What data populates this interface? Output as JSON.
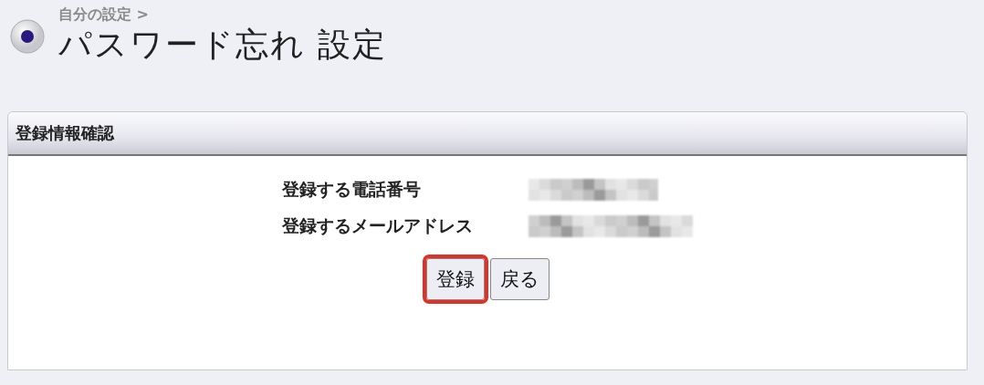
{
  "breadcrumb": "自分の設定 >",
  "title": "パスワード忘れ 設定",
  "panel": {
    "heading": "登録情報確認",
    "rows": [
      {
        "label": "登録する電話番号",
        "value": {
          "kind": "redacted"
        }
      },
      {
        "label": "登録するメールアドレス",
        "value": {
          "kind": "redacted"
        }
      }
    ],
    "buttons": [
      {
        "label": "登録",
        "highlighted": true
      },
      {
        "label": "戻る",
        "highlighted": false
      }
    ]
  }
}
